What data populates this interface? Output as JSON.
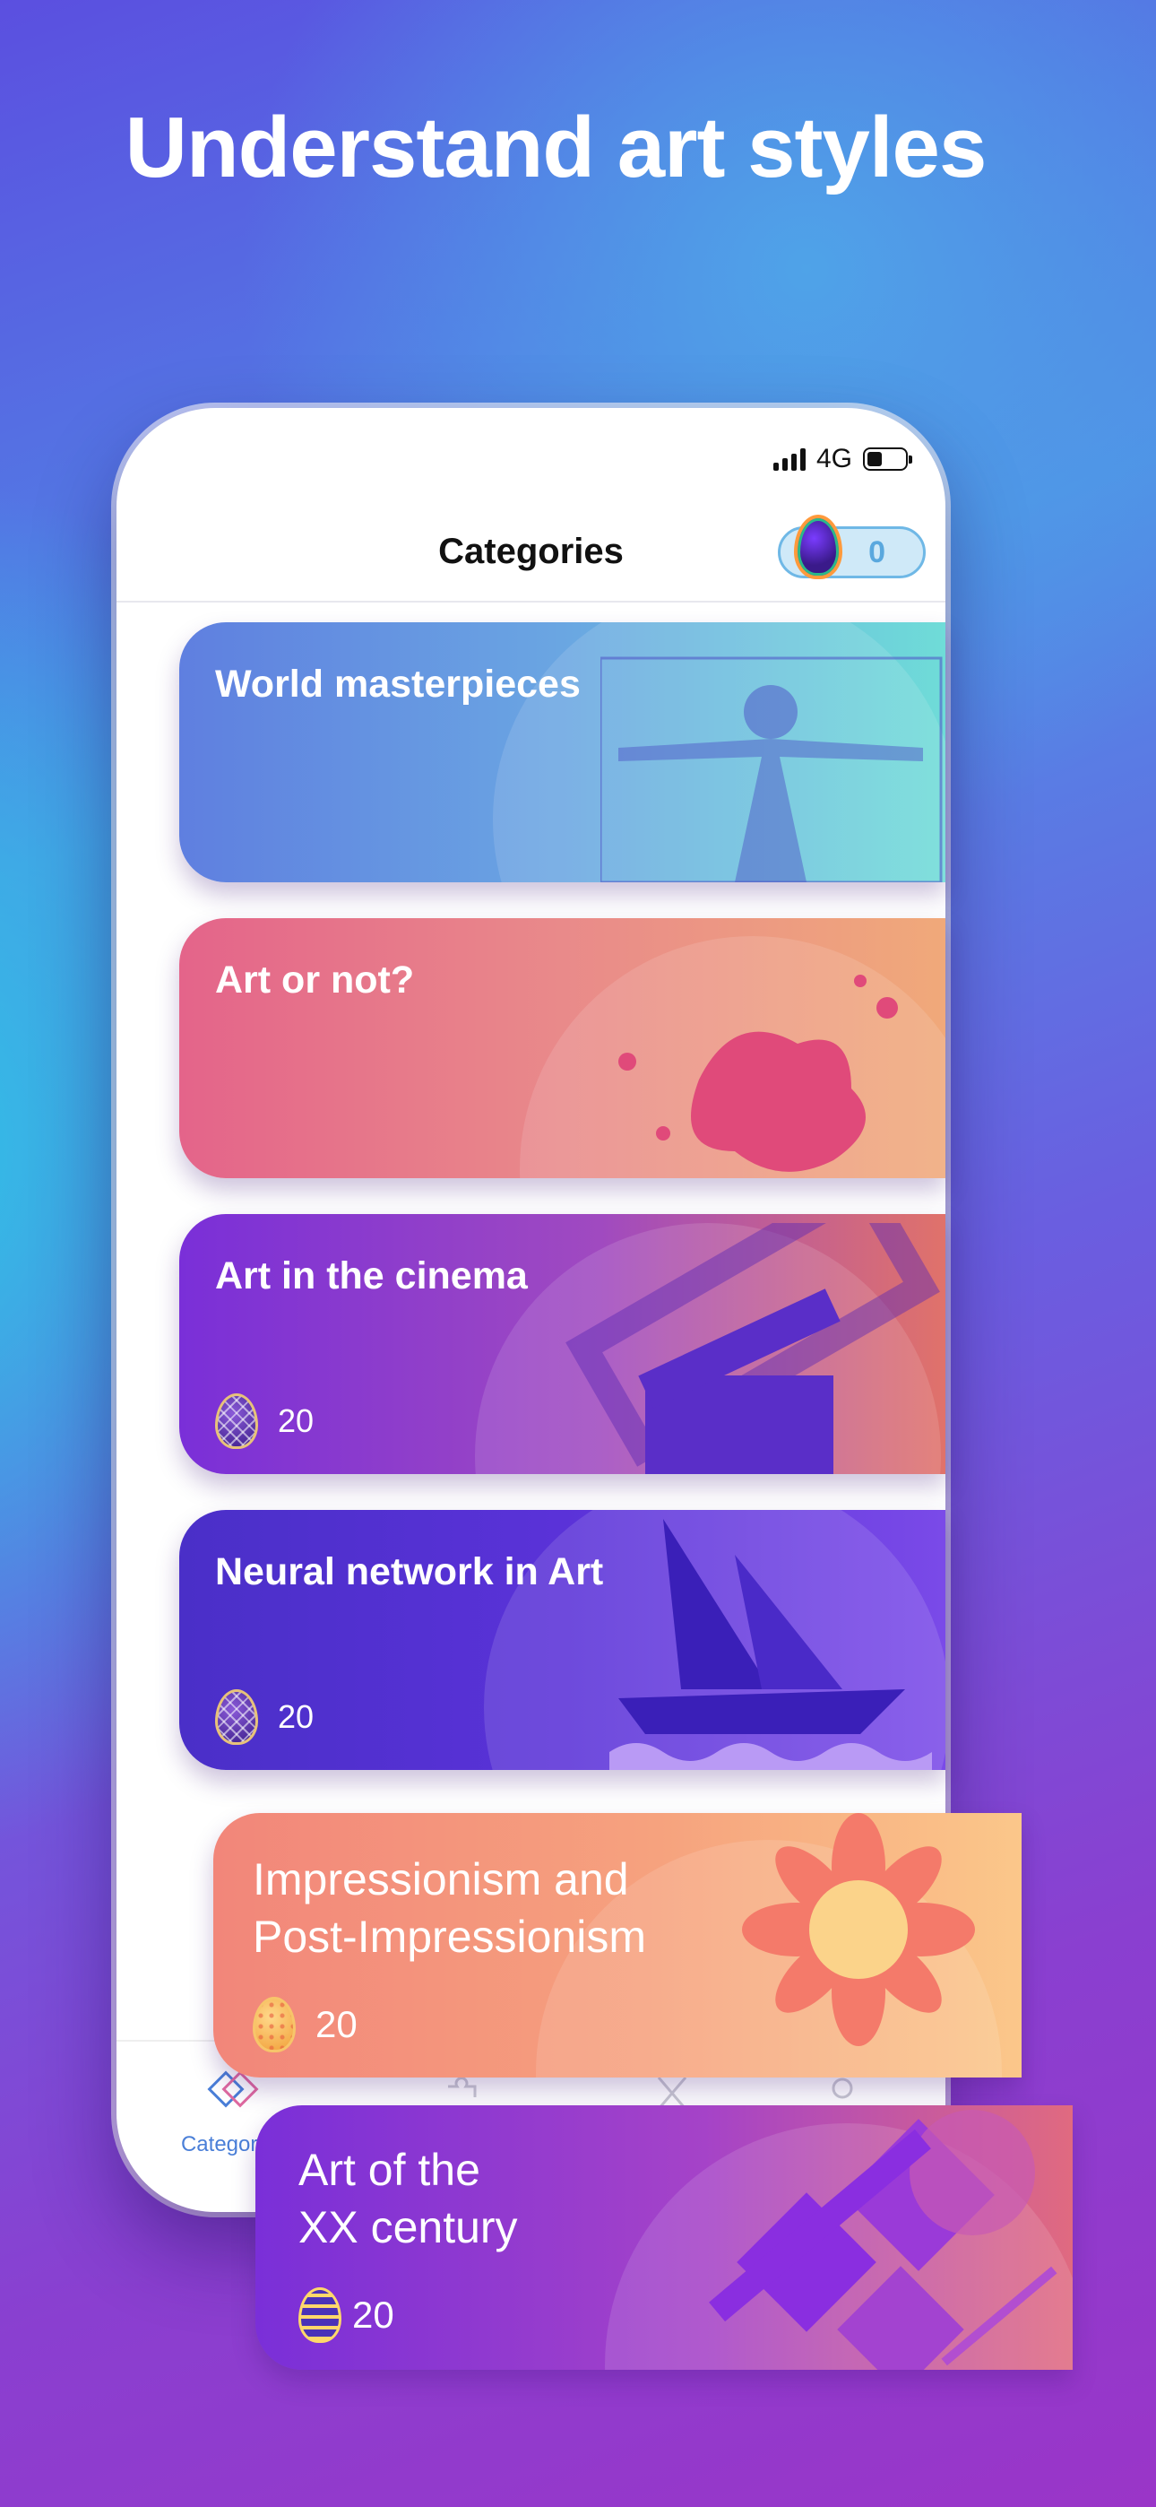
{
  "headline": "Understand art styles",
  "status_bar": {
    "network": "4G"
  },
  "nav": {
    "title": "Categories",
    "coins": "0"
  },
  "categories": [
    {
      "title": "World masterpieces",
      "cost": ""
    },
    {
      "title": "Art or not?",
      "cost": ""
    },
    {
      "title": "Art in the cinema",
      "cost": "20"
    },
    {
      "title": "Neural network in Art",
      "cost": "20"
    }
  ],
  "floating_cards": [
    {
      "title_line1": "Impressionism and",
      "title_line2": "Post-Impressionism",
      "cost": "20"
    },
    {
      "title_line1": "Art of the",
      "title_line2": "XX century",
      "cost": "20"
    }
  ],
  "tabbar": {
    "active_label": "Categories"
  },
  "colors": {
    "accent": "#4a7fd8",
    "coin_border": "#6fb8e6",
    "coin_fill": "#cfe9f8"
  },
  "icons": [
    "signal-icon",
    "battery-icon",
    "egg-coin-icon",
    "categories-tab-icon",
    "puzzle-tab-icon",
    "crossed-tab-icon",
    "profile-tab-icon"
  ]
}
